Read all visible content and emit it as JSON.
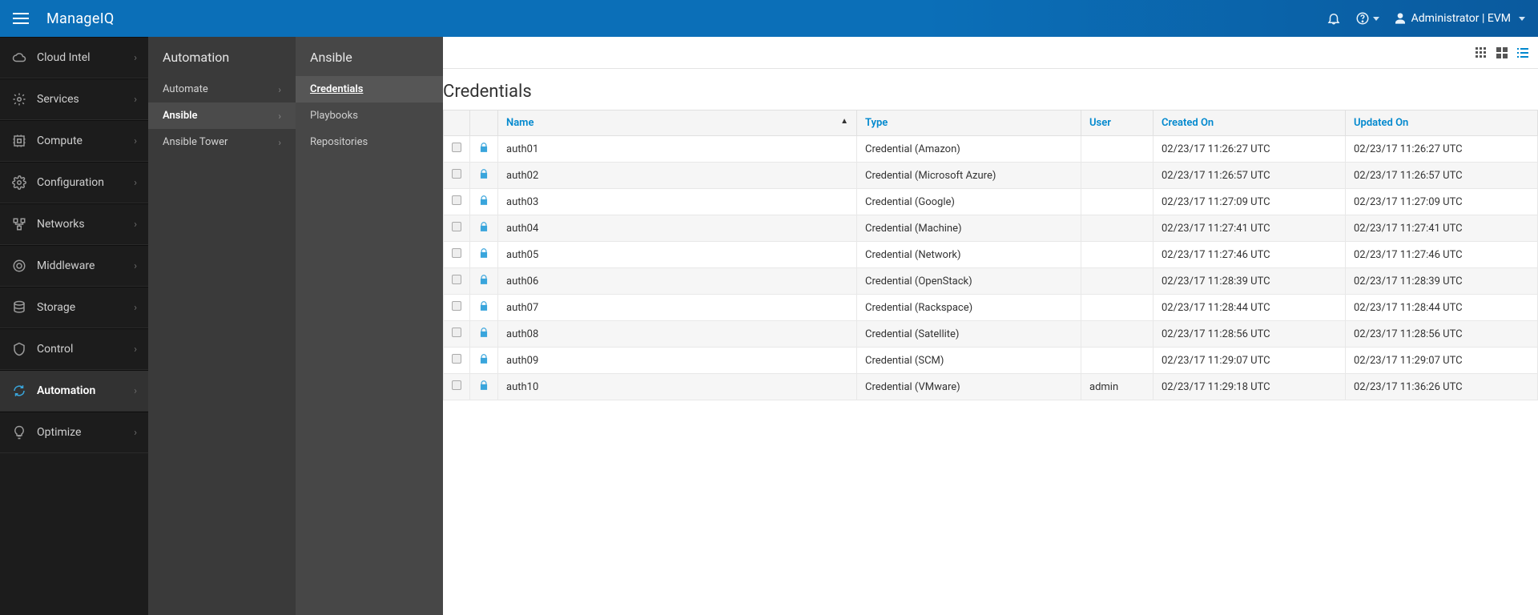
{
  "brand": "ManageIQ",
  "user": {
    "label": "Administrator | EVM"
  },
  "sidebar": {
    "items": [
      {
        "id": "cloud-intel",
        "label": "Cloud Intel"
      },
      {
        "id": "services",
        "label": "Services"
      },
      {
        "id": "compute",
        "label": "Compute"
      },
      {
        "id": "configuration",
        "label": "Configuration"
      },
      {
        "id": "networks",
        "label": "Networks"
      },
      {
        "id": "middleware",
        "label": "Middleware"
      },
      {
        "id": "storage",
        "label": "Storage"
      },
      {
        "id": "control",
        "label": "Control"
      },
      {
        "id": "automation",
        "label": "Automation"
      },
      {
        "id": "optimize",
        "label": "Optimize"
      }
    ],
    "active": "automation"
  },
  "secondary": {
    "title": "Automation",
    "items": [
      {
        "id": "automate",
        "label": "Automate"
      },
      {
        "id": "ansible",
        "label": "Ansible"
      },
      {
        "id": "ansible-tower",
        "label": "Ansible Tower"
      }
    ],
    "active": "ansible"
  },
  "tertiary": {
    "title": "Ansible",
    "items": [
      {
        "id": "credentials",
        "label": "Credentials"
      },
      {
        "id": "playbooks",
        "label": "Playbooks"
      },
      {
        "id": "repositories",
        "label": "Repositories"
      }
    ],
    "active": "credentials"
  },
  "page": {
    "title": "Credentials"
  },
  "table": {
    "columns": {
      "name": "Name",
      "type": "Type",
      "user": "User",
      "created": "Created On",
      "updated": "Updated On"
    },
    "sort": {
      "column": "name",
      "dir": "asc"
    },
    "rows": [
      {
        "name": "auth01",
        "type": "Credential (Amazon)",
        "user": "",
        "created": "02/23/17 11:26:27 UTC",
        "updated": "02/23/17 11:26:27 UTC"
      },
      {
        "name": "auth02",
        "type": "Credential (Microsoft Azure)",
        "user": "",
        "created": "02/23/17 11:26:57 UTC",
        "updated": "02/23/17 11:26:57 UTC"
      },
      {
        "name": "auth03",
        "type": "Credential (Google)",
        "user": "",
        "created": "02/23/17 11:27:09 UTC",
        "updated": "02/23/17 11:27:09 UTC"
      },
      {
        "name": "auth04",
        "type": "Credential (Machine)",
        "user": "",
        "created": "02/23/17 11:27:41 UTC",
        "updated": "02/23/17 11:27:41 UTC"
      },
      {
        "name": "auth05",
        "type": "Credential (Network)",
        "user": "",
        "created": "02/23/17 11:27:46 UTC",
        "updated": "02/23/17 11:27:46 UTC"
      },
      {
        "name": "auth06",
        "type": "Credential (OpenStack)",
        "user": "",
        "created": "02/23/17 11:28:39 UTC",
        "updated": "02/23/17 11:28:39 UTC"
      },
      {
        "name": "auth07",
        "type": "Credential (Rackspace)",
        "user": "",
        "created": "02/23/17 11:28:44 UTC",
        "updated": "02/23/17 11:28:44 UTC"
      },
      {
        "name": "auth08",
        "type": "Credential (Satellite)",
        "user": "",
        "created": "02/23/17 11:28:56 UTC",
        "updated": "02/23/17 11:28:56 UTC"
      },
      {
        "name": "auth09",
        "type": "Credential (SCM)",
        "user": "",
        "created": "02/23/17 11:29:07 UTC",
        "updated": "02/23/17 11:29:07 UTC"
      },
      {
        "name": "auth10",
        "type": "Credential (VMware)",
        "user": "admin",
        "created": "02/23/17 11:29:18 UTC",
        "updated": "02/23/17 11:36:26 UTC"
      }
    ]
  }
}
